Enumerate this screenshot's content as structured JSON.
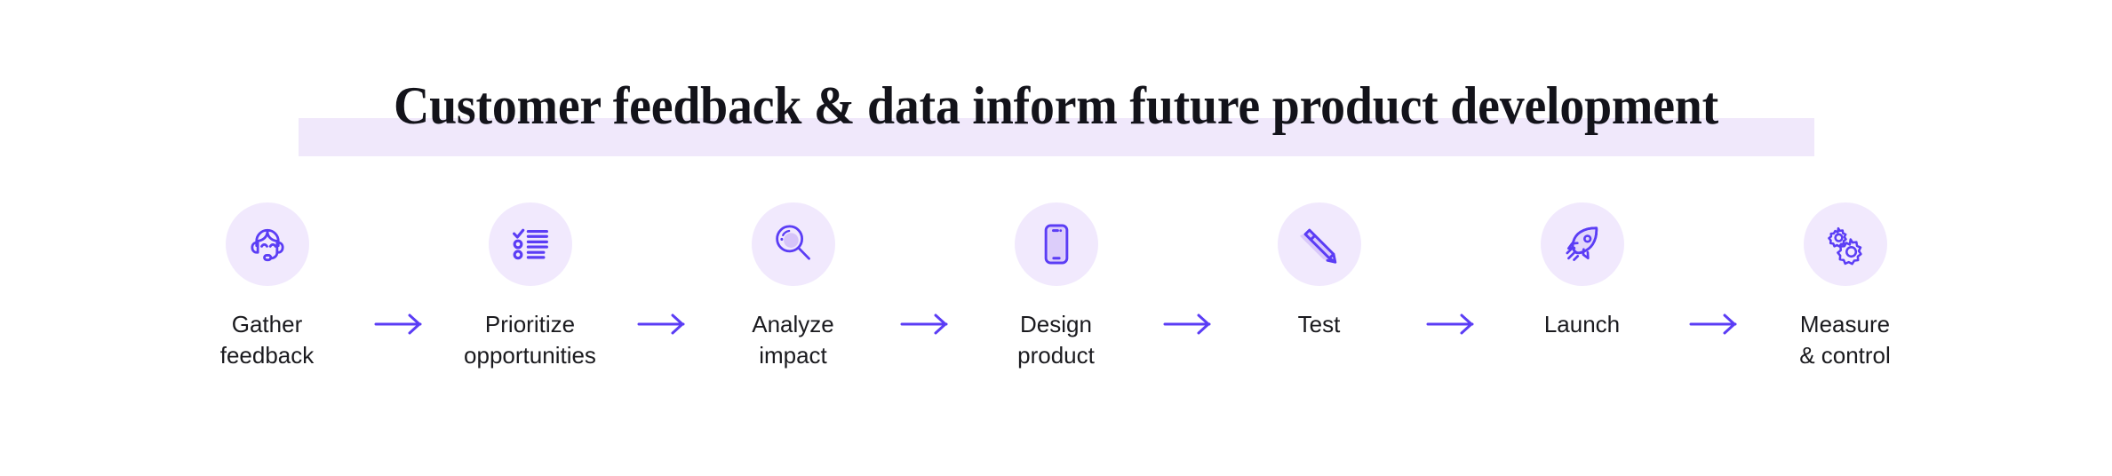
{
  "header": {
    "title": "Customer feedback & data inform future product development",
    "highlight_color": "#f0e8fb",
    "title_color": "#13131a"
  },
  "theme": {
    "accent": "#5b3df5",
    "icon_bg": "#f1e9fd",
    "icon_fill_light": "#d9c8fa",
    "background": "#ffffff",
    "label_color": "#1a1a1e"
  },
  "flow": {
    "arrow_icon": "arrow-right-icon",
    "steps": [
      {
        "index": 1,
        "label": "Gather\nfeedback",
        "icon": "headset-support-agent-icon"
      },
      {
        "index": 2,
        "label": "Prioritize\nopportunities",
        "icon": "checklist-icon"
      },
      {
        "index": 3,
        "label": "Analyze\nimpact",
        "icon": "magnifying-glass-icon"
      },
      {
        "index": 4,
        "label": "Design\nproduct",
        "icon": "smartphone-icon"
      },
      {
        "index": 5,
        "label": "Test",
        "icon": "pencil-icon"
      },
      {
        "index": 6,
        "label": "Launch",
        "icon": "rocket-icon"
      },
      {
        "index": 7,
        "label": "Measure\n& control",
        "icon": "gears-icon"
      }
    ]
  }
}
